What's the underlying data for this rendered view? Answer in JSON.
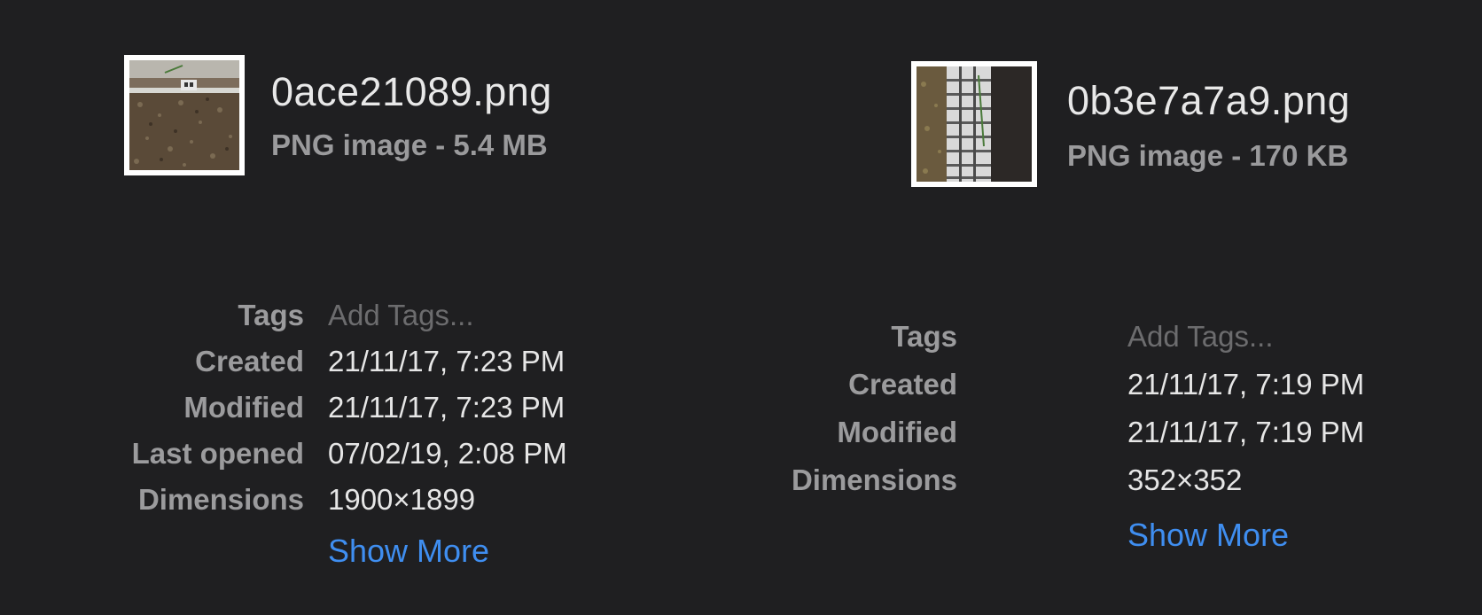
{
  "files": [
    {
      "name": "0ace21089.png",
      "kind": "PNG image - 5.4 MB",
      "meta": [
        {
          "label": "Tags",
          "value": "Add Tags..."
        },
        {
          "label": "Created",
          "value": "21/11/17, 7:23 PM"
        },
        {
          "label": "Modified",
          "value": "21/11/17, 7:23 PM"
        },
        {
          "label": "Last opened",
          "value": "07/02/19, 2:08 PM"
        },
        {
          "label": "Dimensions",
          "value": "1900×1899"
        }
      ],
      "show_more": "Show More"
    },
    {
      "name": "0b3e7a7a9.png",
      "kind": "PNG image - 170 KB",
      "meta": [
        {
          "label": "Tags",
          "value": "Add Tags..."
        },
        {
          "label": "Created",
          "value": "21/11/17, 7:19 PM"
        },
        {
          "label": "Modified",
          "value": "21/11/17, 7:19 PM"
        },
        {
          "label": "Dimensions",
          "value": "352×352"
        }
      ],
      "show_more": "Show More"
    }
  ],
  "colors": {
    "background": "#1f1f21",
    "link": "#3f8ef0",
    "label": "#9b9b9d",
    "value": "#e6e6e6",
    "placeholder": "#6c6c6e"
  }
}
